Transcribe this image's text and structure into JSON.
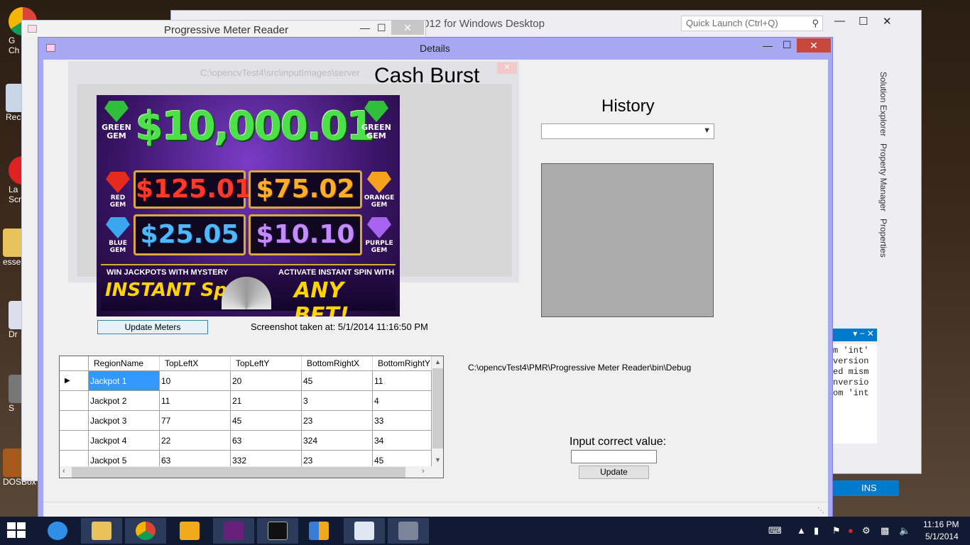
{
  "desktop": {
    "icons": [
      {
        "label": "G\nCh"
      },
      {
        "label": "Rec"
      },
      {
        "label": "La\nScr"
      },
      {
        "label": "esse"
      },
      {
        "label": "Dr"
      },
      {
        "label": "S"
      },
      {
        "label": "DOSBox"
      }
    ]
  },
  "vs": {
    "title": "012 for Windows Desktop",
    "quick_launch_placeholder": "Quick Launch (Ctrl+Q)",
    "side_tabs": [
      "Solution Explorer",
      "Property Manager",
      "Properties"
    ],
    "output_lines": [
      "",
      "m 'int'",
      "version",
      "ed mism",
      "nversio",
      "om 'int"
    ],
    "status": "INS"
  },
  "pmr_window": {
    "title": "Progressive Meter Reader"
  },
  "details_window": {
    "title": "Details",
    "ghost_path": "C:\\opencvTest4\\src\\inputImages\\server"
  },
  "game": {
    "name": "Cash Burst",
    "jackpot_top": "$10,000.01",
    "gem_green": "GREEN\nGEM",
    "jackpot_red": "$125.01",
    "gem_red": "RED\nGEM",
    "jackpot_orange": "$75.02",
    "gem_orange": "ORANGE\nGEM",
    "jackpot_blue": "$25.05",
    "gem_blue": "BLUE\nGEM",
    "jackpot_purple": "$10.10",
    "gem_purple": "PURPLE\nGEM",
    "banner_left_line1": "WIN JACKPOTS WITH MYSTERY",
    "banner_left_line2": "INSTANT Spin!",
    "banner_right_line1": "ACTIVATE INSTANT SPIN WITH",
    "banner_right_line2": "ANY BET!"
  },
  "controls": {
    "update_meters_label": "Update Meters",
    "screenshot_label": "Screenshot taken at:  5/1/2014 11:16:50 PM",
    "history_label": "History",
    "history_selected": "",
    "path_label": "C:\\opencvTest4\\PMR\\Progressive Meter Reader\\bin\\Debug",
    "input_label": "Input correct value:",
    "input_value": "",
    "update_label": "Update"
  },
  "grid": {
    "columns": [
      "RegionName",
      "TopLeftX",
      "TopLeftY",
      "BottomRightX",
      "BottomRightY"
    ],
    "rows": [
      [
        "Jackpot 1",
        "10",
        "20",
        "45",
        "11"
      ],
      [
        "Jackpot 2",
        "11",
        "21",
        "3",
        "4"
      ],
      [
        "Jackpot 3",
        "77",
        "45",
        "23",
        "33"
      ],
      [
        "Jackpot 4",
        "22",
        "63",
        "324",
        "34"
      ],
      [
        "Jackpot 5",
        "63",
        "332",
        "23",
        "45"
      ]
    ]
  },
  "taskbar": {
    "apps": [
      "internet-explorer-icon",
      "file-explorer-icon",
      "chrome-icon",
      "winamp-icon",
      "visual-studio-icon",
      "command-prompt-icon",
      "control-panel-icon",
      "document-icon",
      "window-icon"
    ],
    "time": "11:16 PM",
    "date": "5/1/2014"
  }
}
